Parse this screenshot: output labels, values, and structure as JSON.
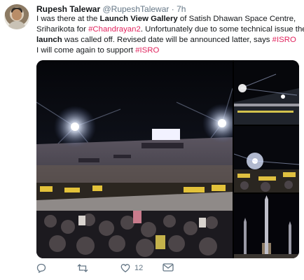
{
  "author": {
    "name": "Rupesh Talewar",
    "handle": "@RupeshTalewar",
    "separator": "·",
    "time": "7h"
  },
  "tweet_text": {
    "l1_a": "I was there at the ",
    "l1_b": "Launch View Gallery",
    "l1_c": " of Satish Dhawan Space Centre,",
    "l2_a": "Sriharikota for ",
    "l2_b": "#Chandrayan2",
    "l2_c": ". Unfortunately due to some technical issue the",
    "l3_a": "launch",
    "l3_b": " was called off. Revised date will be announced latter, says ",
    "l3_c": "#ISRO",
    "l4_a": "I will come again to support ",
    "l4_b": "#ISRO"
  },
  "actions": {
    "reply_icon": "reply-icon",
    "retweet_icon": "retweet-icon",
    "like_icon": "heart-icon",
    "like_count": "12",
    "dm_icon": "envelope-icon"
  },
  "colors": {
    "hashtag": "#e0245e",
    "meta": "#657786"
  }
}
